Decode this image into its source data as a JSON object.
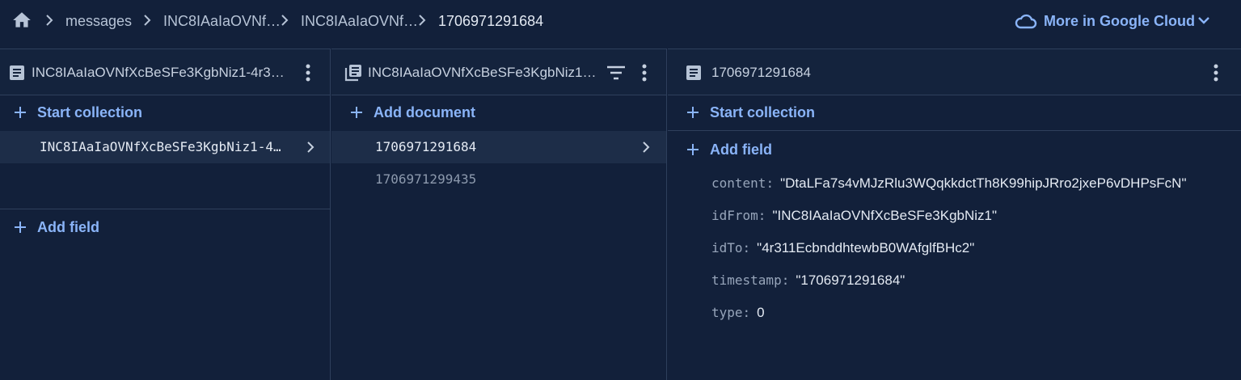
{
  "breadcrumb": {
    "home_icon": "home-icon",
    "items": [
      "messages",
      "INC8IAaIaOVNf…",
      "INC8IAaIaOVNf…",
      "1706971291684"
    ],
    "more_link": {
      "label": "More in Google Cloud",
      "icon": "cloud-icon"
    }
  },
  "panels": [
    {
      "title": "INC8IAaIaOVNfXcBeSFe3KgbNiz1-4r31…",
      "icon": "document-icon",
      "start_collection_label": "Start collection",
      "rows": [
        {
          "text": "INC8IAaIaOVNfXcBeSFe3KgbNiz1-4…",
          "selected": true
        }
      ],
      "add_field_label": "Add field"
    },
    {
      "title": "INC8IAaIaOVNfXcBeSFe3KgbNiz1-…",
      "icon": "collection-icon",
      "add_document_label": "Add document",
      "rows": [
        {
          "text": "1706971291684",
          "selected": true
        },
        {
          "text": "1706971299435",
          "selected": false
        }
      ]
    },
    {
      "title": "1706971291684",
      "icon": "document-icon",
      "start_collection_label": "Start collection",
      "add_field_label": "Add field",
      "fields": [
        {
          "key": "content",
          "value": "\"DtaLFa7s4vMJzRlu3WQqkkdctTh8K99hipJRro2jxeP6vDHPsFcN\""
        },
        {
          "key": "idFrom",
          "value": "\"INC8IAaIaOVNfXcBeSFe3KgbNiz1\""
        },
        {
          "key": "idTo",
          "value": "\"4r311EcbnddhtewbB0WAfglfBHc2\""
        },
        {
          "key": "timestamp",
          "value": "\"1706971291684\""
        },
        {
          "key": "type",
          "value": "0"
        }
      ]
    }
  ],
  "colors": {
    "background": "#12203a",
    "accent": "#8ab4f8",
    "selected_row": "#1d2d48",
    "border": "#2e3f5c"
  }
}
